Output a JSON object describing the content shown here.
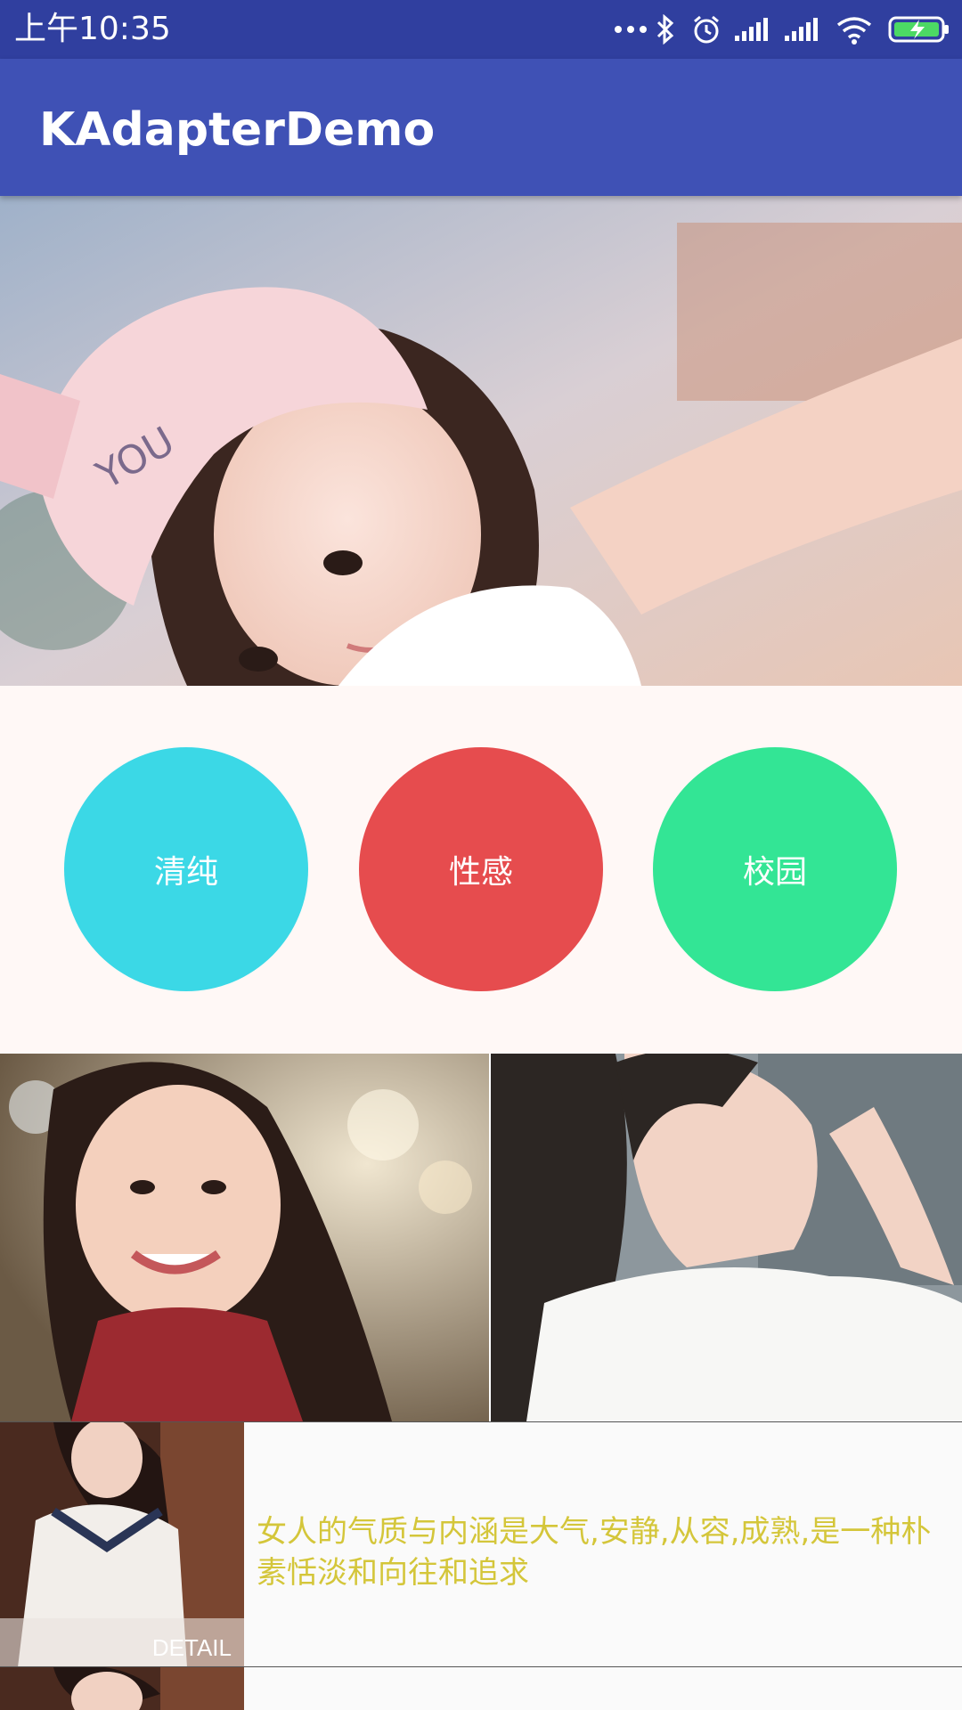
{
  "status_bar": {
    "time": "上午10:35",
    "icons": [
      "more-dots-icon",
      "bluetooth-icon",
      "alarm-icon",
      "signal-icon",
      "signal-icon",
      "wifi-icon",
      "battery-charging-icon"
    ]
  },
  "app_bar": {
    "title": "KAdapterDemo"
  },
  "categories": [
    {
      "label": "清纯",
      "color": "#3bd8e6"
    },
    {
      "label": "性感",
      "color": "#e64c4e"
    },
    {
      "label": "校园",
      "color": "#33e595"
    }
  ],
  "detail_rows": [
    {
      "caption": "DETAIL",
      "text": "女人的气质与内涵是大气,安静,从容,成熟,是一种朴素恬淡和向往和追求"
    }
  ],
  "colors": {
    "status_bar": "#303f9f",
    "app_bar": "#3f51b5",
    "category_bg": "#fff8f6",
    "detail_text": "#d4c63a"
  }
}
